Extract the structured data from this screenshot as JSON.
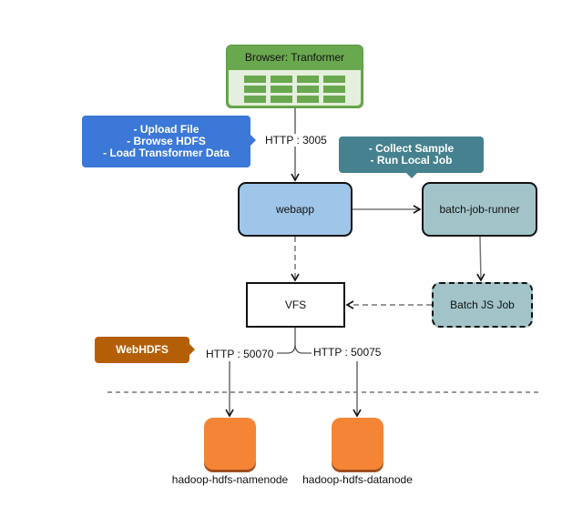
{
  "diagram": {
    "browser": {
      "title": "Browser: Tranformer",
      "icon": "table-grid-icon",
      "color": "#6aa84f"
    },
    "callouts": {
      "webapp_features": {
        "lines": [
          "- Upload File",
          "- Browse HDFS",
          "- Load Transformer Data"
        ],
        "color": "#3c78d8"
      },
      "runner_features": {
        "lines": [
          "- Collect Sample",
          "- Run Local Job"
        ],
        "color": "#45818e"
      },
      "webhdfs": {
        "label": "WebHDFS",
        "color": "#b45f06"
      }
    },
    "nodes": {
      "webapp": {
        "label": "webapp",
        "color": "#9fc5e8"
      },
      "batch_job_runner": {
        "label": "batch-job-runner",
        "color": "#a2c4c9"
      },
      "batch_js_job": {
        "label": "Batch JS Job",
        "color": "#a2c4c9"
      },
      "vfs": {
        "label": "VFS"
      },
      "namenode": {
        "label": "hadoop-hdfs-namenode",
        "color": "#f58536"
      },
      "datanode": {
        "label": "hadoop-hdfs-datanode",
        "color": "#f58536"
      }
    },
    "edges": {
      "browser_to_webapp": {
        "label": "HTTP : 3005",
        "style": "solid"
      },
      "webapp_to_runner": {
        "label": "",
        "style": "solid"
      },
      "runner_to_batchjs": {
        "label": "",
        "style": "solid"
      },
      "batchjs_to_vfs": {
        "label": "",
        "style": "dashed"
      },
      "webapp_to_vfs": {
        "label": "",
        "style": "dashed"
      },
      "vfs_to_namenode": {
        "label": "HTTP : 50070",
        "style": "solid"
      },
      "vfs_to_datanode": {
        "label": "HTTP : 50075",
        "style": "solid"
      }
    },
    "separator": {
      "style": "dashed"
    }
  }
}
